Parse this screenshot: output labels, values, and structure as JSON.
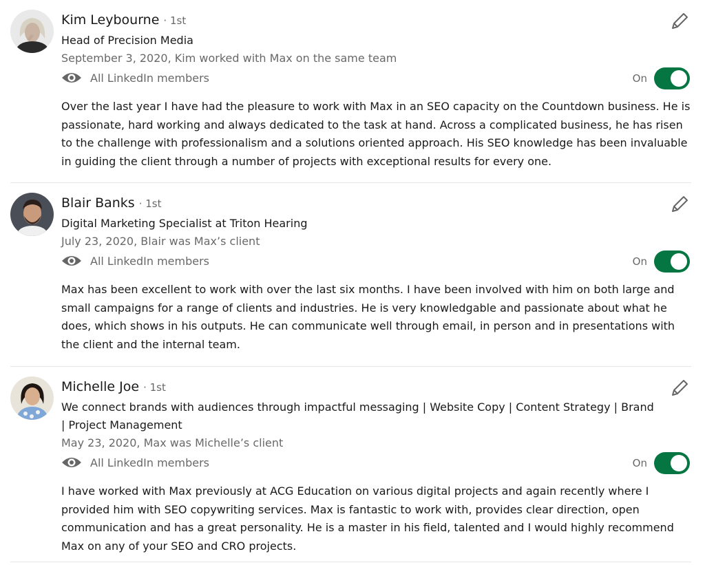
{
  "visibility_label": "All LinkedIn members",
  "toggle_label": "On",
  "colors": {
    "toggle_on": "#057642",
    "icon": "#666666",
    "divider": "#e6e6e6"
  },
  "recommendations": [
    {
      "name": "Kim Leybourne",
      "degree": "· 1st",
      "headline": "Head of Precision Media",
      "meta": "September 3, 2020, Kim worked with Max on the same team",
      "text": "Over the last year I have had the pleasure to work with Max in an SEO capacity on the Countdown business. He is passionate, hard working and always dedicated to the task at hand. Across a complicated business, he has risen to the challenge with professionalism and a solutions oriented approach. His SEO knowledge has been invaluable in guiding the client through a number of projects with exceptional results for every one."
    },
    {
      "name": "Blair Banks",
      "degree": "· 1st",
      "headline": "Digital Marketing Specialist at Triton Hearing",
      "meta": "July 23, 2020, Blair was Max’s client",
      "text": "Max has been excellent to work with over the last six months. I have been involved with him on both large and small campaigns for a range of clients and industries. He is very knowledgable and passionate about what he does, which shows in his outputs. He can communicate well through email, in person and in presentations with the client and the internal team."
    },
    {
      "name": "Michelle Joe",
      "degree": "· 1st",
      "headline": "We connect brands with audiences through impactful messaging | Website Copy | Content Strategy | Brand | Project Management",
      "meta": "May 23, 2020, Max was Michelle’s client",
      "text": "I have worked with Max previously at ACG Education on various digital projects and again recently where I provided him with SEO copywriting services. Max is fantastic to work with, provides clear direction, open communication and has a great personality. He is a master in his field, talented and I would highly recommend Max on any of your SEO and CRO projects."
    }
  ]
}
